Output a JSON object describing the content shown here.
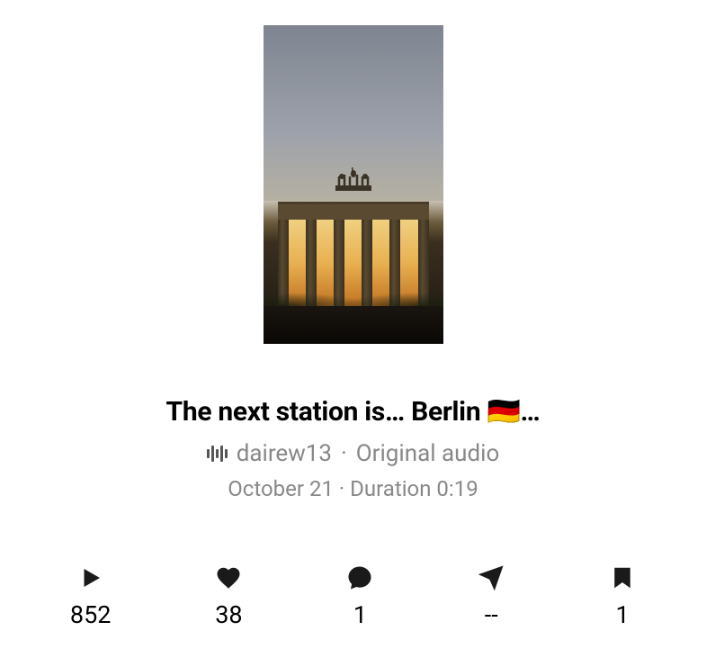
{
  "post": {
    "title": "The next station is… Berlin 🇩🇪…",
    "username": "dairew13",
    "audio_label": "Original audio",
    "separator": "·",
    "date": "October 21",
    "duration_label": "Duration 0:19"
  },
  "stats": {
    "plays": "852",
    "likes": "38",
    "comments": "1",
    "shares": "--",
    "saves": "1"
  }
}
